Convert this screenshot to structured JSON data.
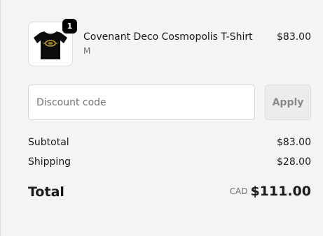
{
  "line_item": {
    "quantity": "1",
    "product_name": "Covenant Deco Cosmopolis T-Shirt",
    "variant": "M",
    "price": "$83.00"
  },
  "discount": {
    "placeholder": "Discount code",
    "value": "",
    "apply_label": "Apply"
  },
  "summary": {
    "subtotal_label": "Subtotal",
    "subtotal_value": "$83.00",
    "shipping_label": "Shipping",
    "shipping_value": "$28.00",
    "total_label": "Total",
    "currency": "CAD",
    "total_value": "$111.00"
  },
  "icons": {
    "product_thumbnail": "black-t-shirt-with-gold-emblem"
  },
  "colors": {
    "page_background": "#f4f4f4",
    "badge_background": "#000000",
    "apply_button_background": "#ececec",
    "apply_button_text": "#8a8a8a",
    "muted_text": "#707070"
  }
}
